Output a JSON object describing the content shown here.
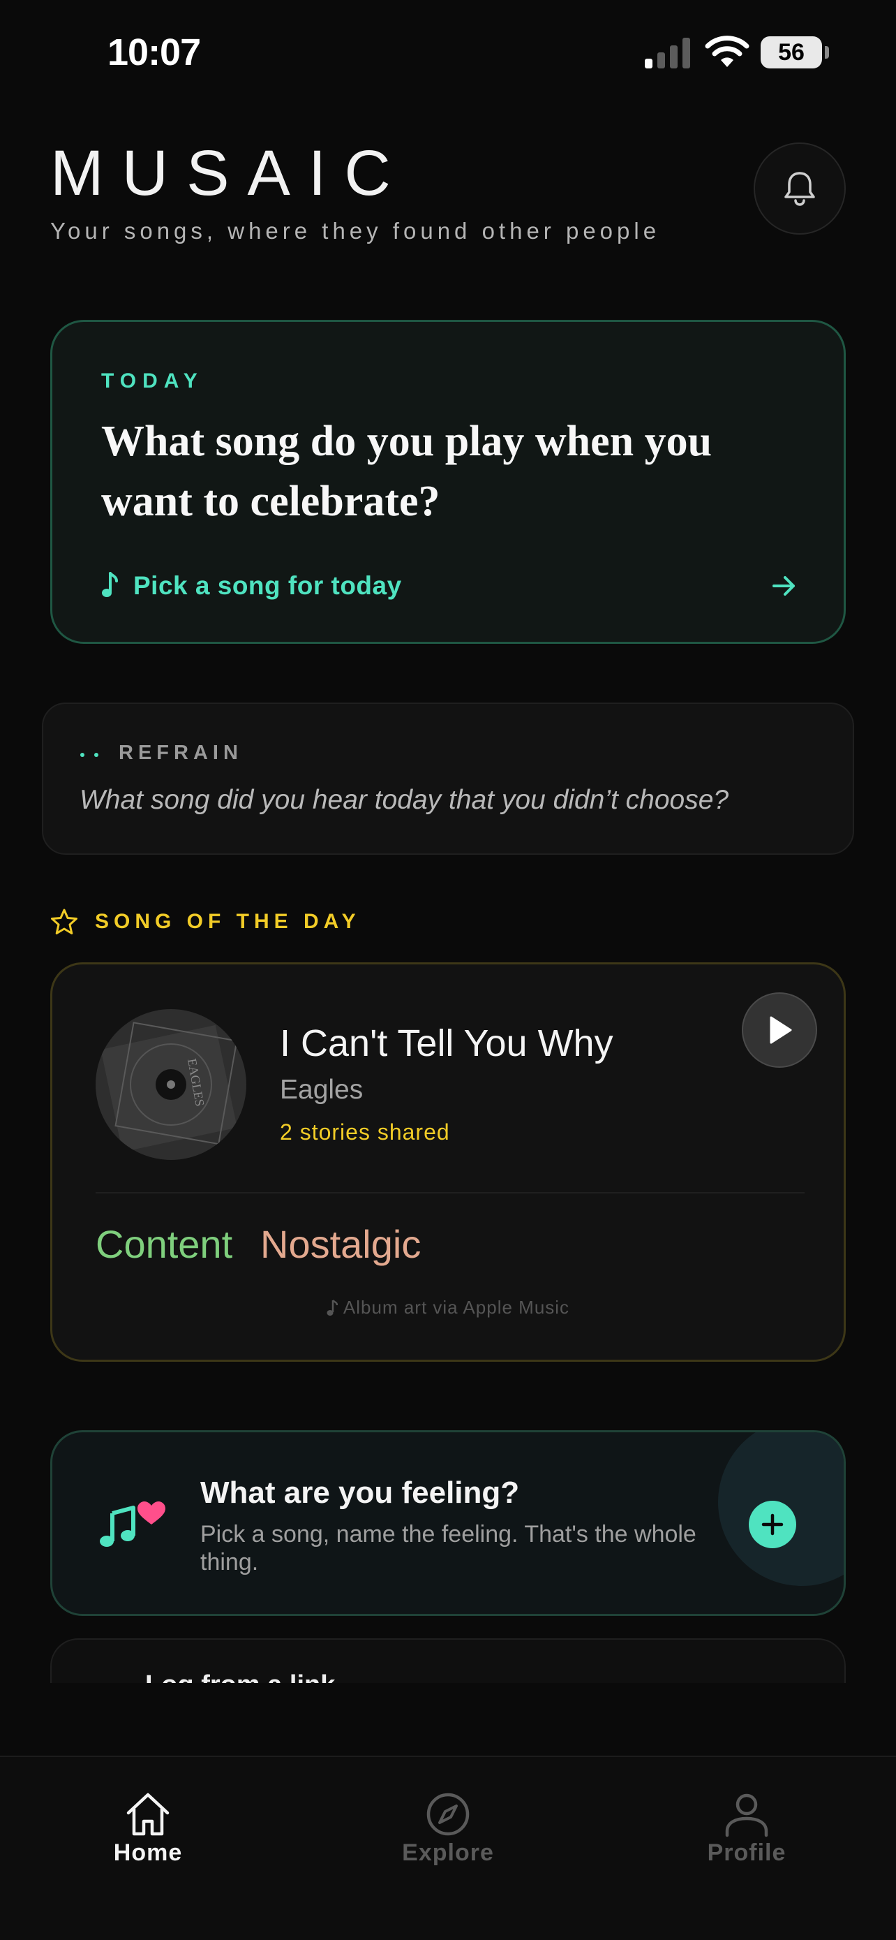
{
  "status_bar": {
    "time": "10:07",
    "battery": "56"
  },
  "header": {
    "brand": "MUSAIC",
    "tagline": "Your songs, where they found other people",
    "bell_icon": "bell-icon"
  },
  "today": {
    "label": "TODAY",
    "question": "What song do you play when you want to celebrate?",
    "action_label": "Pick a song for today",
    "action_icon": "music-note-icon",
    "accent_color": "#4fe3c0"
  },
  "refrain": {
    "label": "REFRAIN",
    "prompt": "What song did you hear today that you didn’t choose?"
  },
  "song_of_the_day": {
    "label": "SONG OF THE DAY",
    "title": "I Can't Tell You Why",
    "artist": "Eagles",
    "stories": "2 stories shared",
    "album_art_text": "EAGLES",
    "moods": [
      {
        "label": "Content",
        "color": "#7fcf7d"
      },
      {
        "label": "Nostalgic",
        "color": "#e3a98f"
      }
    ],
    "attribution": "Album art via Apple Music",
    "accent_color": "#f2cc27"
  },
  "feeling": {
    "title": "What are you feeling?",
    "subtitle": "Pick a song, name the feeling. That's the whole thing."
  },
  "log_link": {
    "title": "Log from a link"
  },
  "tabs": [
    {
      "label": "Home",
      "icon": "home-icon",
      "active": true
    },
    {
      "label": "Explore",
      "icon": "compass-icon",
      "active": false
    },
    {
      "label": "Profile",
      "icon": "person-icon",
      "active": false
    }
  ]
}
